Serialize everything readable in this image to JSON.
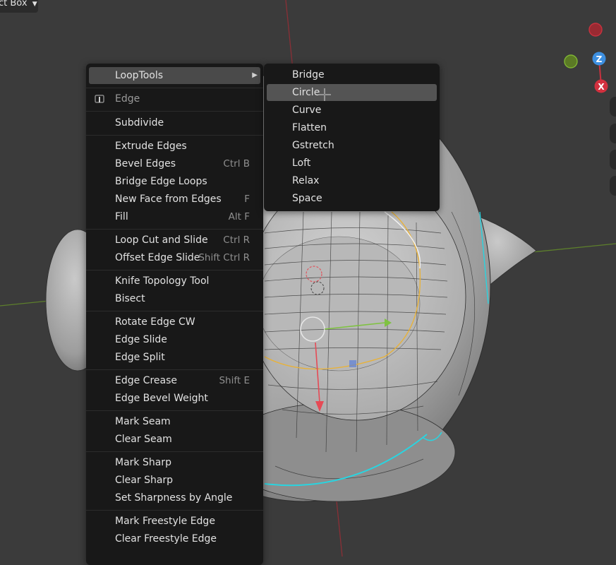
{
  "header_select": {
    "label": "ct Box"
  },
  "edge_menu": {
    "submenu_trigger": "LoopTools",
    "title": "Edge",
    "groups": [
      [
        {
          "label": "Subdivide",
          "shortcut": ""
        }
      ],
      [
        {
          "label": "Extrude Edges",
          "shortcut": ""
        },
        {
          "label": "Bevel Edges",
          "shortcut": "Ctrl B"
        },
        {
          "label": "Bridge Edge Loops",
          "shortcut": ""
        },
        {
          "label": "New Face from Edges",
          "shortcut": "F"
        },
        {
          "label": "Fill",
          "shortcut": "Alt F"
        }
      ],
      [
        {
          "label": "Loop Cut and Slide",
          "shortcut": "Ctrl R"
        },
        {
          "label": "Offset Edge Slide",
          "shortcut": "Shift Ctrl R"
        }
      ],
      [
        {
          "label": "Knife Topology Tool",
          "shortcut": ""
        },
        {
          "label": "Bisect",
          "shortcut": ""
        }
      ],
      [
        {
          "label": "Rotate Edge CW",
          "shortcut": ""
        },
        {
          "label": "Edge Slide",
          "shortcut": ""
        },
        {
          "label": "Edge Split",
          "shortcut": ""
        }
      ],
      [
        {
          "label": "Edge Crease",
          "shortcut": "Shift E"
        },
        {
          "label": "Edge Bevel Weight",
          "shortcut": ""
        }
      ],
      [
        {
          "label": "Mark Seam",
          "shortcut": ""
        },
        {
          "label": "Clear Seam",
          "shortcut": ""
        }
      ],
      [
        {
          "label": "Mark Sharp",
          "shortcut": ""
        },
        {
          "label": "Clear Sharp",
          "shortcut": ""
        },
        {
          "label": "Set Sharpness by Angle",
          "shortcut": ""
        }
      ],
      [
        {
          "label": "Mark Freestyle Edge",
          "shortcut": ""
        },
        {
          "label": "Clear Freestyle Edge",
          "shortcut": ""
        }
      ]
    ]
  },
  "looptools_submenu": {
    "items": [
      "Bridge",
      "Circle",
      "Curve",
      "Flatten",
      "Gstretch",
      "Loft",
      "Relax",
      "Space"
    ],
    "highlighted": "Circle"
  },
  "gizmo": {
    "z_label": "Z",
    "x_label": "X"
  },
  "colors": {
    "menu_bg": "#181818",
    "highlight": "#4a4a4a",
    "viewport_bg": "#3b3b3b",
    "axis_red": "#c8323f",
    "axis_green": "#6e9f2c",
    "seam_cyan": "#29d4e0"
  }
}
